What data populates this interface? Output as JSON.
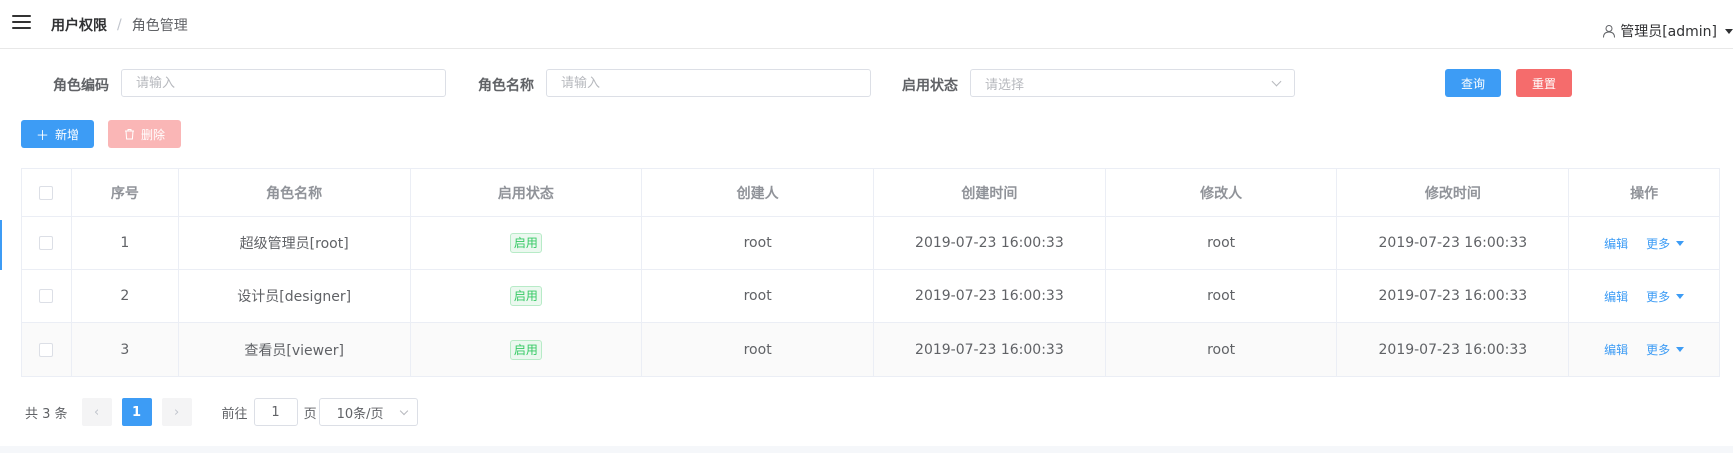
{
  "header": {
    "breadcrumb": [
      "用户权限",
      "角色管理"
    ],
    "breadcrumb_sep": "/",
    "user": "管理员[admin]"
  },
  "filters": {
    "code_label": "角色编码",
    "code_placeholder": "请输入",
    "name_label": "角色名称",
    "name_placeholder": "请输入",
    "status_label": "启用状态",
    "status_placeholder": "请选择"
  },
  "buttons": {
    "query": "查询",
    "reset": "重置",
    "add": "新增",
    "delete": "删除"
  },
  "table": {
    "columns": [
      "序号",
      "角色名称",
      "启用状态",
      "创建人",
      "创建时间",
      "修改人",
      "修改时间",
      "操作"
    ],
    "rows": [
      {
        "index": "1",
        "name": "超级管理员[root]",
        "status": "启用",
        "creator": "root",
        "created": "2019-07-23 16:00:33",
        "modifier": "root",
        "modified": "2019-07-23 16:00:33"
      },
      {
        "index": "2",
        "name": "设计员[designer]",
        "status": "启用",
        "creator": "root",
        "created": "2019-07-23 16:00:33",
        "modifier": "root",
        "modified": "2019-07-23 16:00:33"
      },
      {
        "index": "3",
        "name": "查看员[viewer]",
        "status": "启用",
        "creator": "root",
        "created": "2019-07-23 16:00:33",
        "modifier": "root",
        "modified": "2019-07-23 16:00:33"
      }
    ],
    "edit_label": "编辑",
    "more_label": "更多"
  },
  "pagination": {
    "total": "共 3 条",
    "current_page": "1",
    "goto_prefix": "前往",
    "goto_value": "1",
    "goto_suffix": "页",
    "page_size": "10条/页"
  },
  "colors": {
    "primary": "#3d9cf5",
    "danger": "#f56c6c",
    "success": "#35c964"
  },
  "icons": [
    "hamburger-menu-icon",
    "user-icon",
    "plus-icon",
    "trash-icon",
    "chevron-down-icon",
    "caret-down-icon",
    "chevron-left-icon",
    "chevron-right-icon"
  ]
}
